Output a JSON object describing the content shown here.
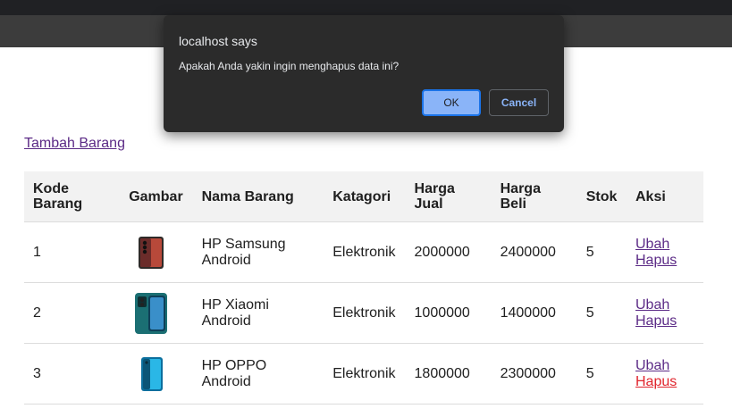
{
  "dialog": {
    "title": "localhost says",
    "message": "Apakah Anda yakin ingin menghapus data ini?",
    "ok_label": "OK",
    "cancel_label": "Cancel"
  },
  "add_link": "Tambah Barang",
  "table": {
    "headers": {
      "kode": "Kode Barang",
      "gambar": "Gambar",
      "nama": "Nama Barang",
      "katagori": "Katagori",
      "harga_jual": "Harga Jual",
      "harga_beli": "Harga Beli",
      "stok": "Stok",
      "aksi": "Aksi"
    },
    "rows": [
      {
        "kode": "1",
        "image_icon": "phone-samsung-icon",
        "nama": "HP Samsung Android",
        "katagori": "Elektronik",
        "harga_jual": "2000000",
        "harga_beli": "2400000",
        "stok": "5",
        "ubah": "Ubah",
        "hapus": "Hapus"
      },
      {
        "kode": "2",
        "image_icon": "phone-xiaomi-icon",
        "nama": "HP Xiaomi Android",
        "katagori": "Elektronik",
        "harga_jual": "1000000",
        "harga_beli": "1400000",
        "stok": "5",
        "ubah": "Ubah",
        "hapus": "Hapus"
      },
      {
        "kode": "3",
        "image_icon": "phone-oppo-icon",
        "nama": "HP OPPO Android",
        "katagori": "Elektronik",
        "harga_jual": "1800000",
        "harga_beli": "2300000",
        "stok": "5",
        "ubah": "Ubah",
        "hapus": "Hapus"
      }
    ]
  },
  "colors": {
    "link": "#5b2a86",
    "link_active": "#e0242c",
    "dialog_bg": "#2b2b2b",
    "ok_button": "#8ab4f8"
  }
}
